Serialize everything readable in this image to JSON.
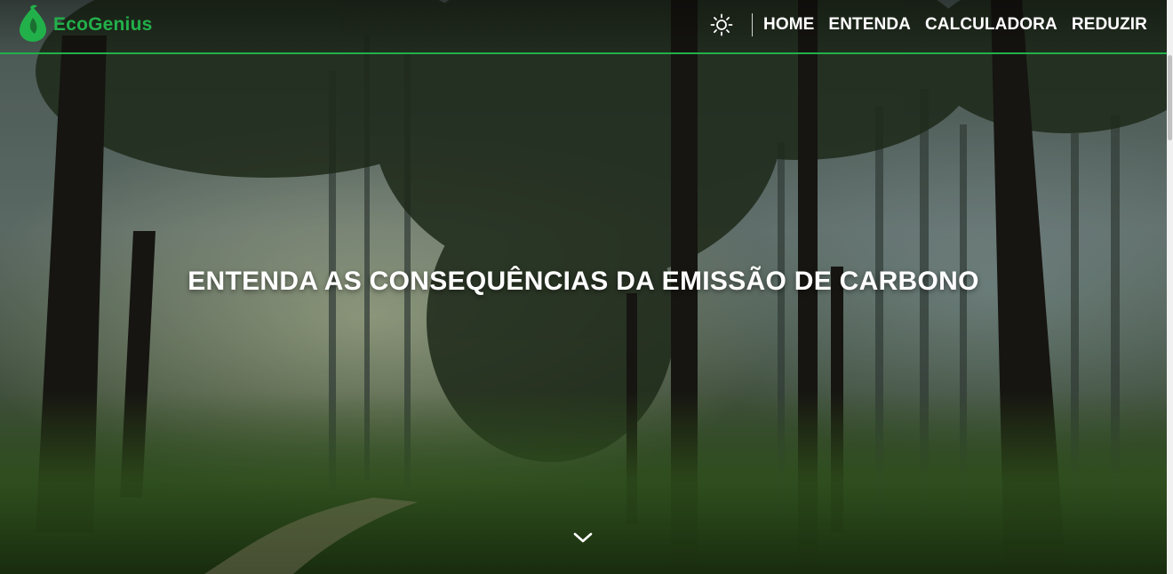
{
  "brand": {
    "name": "EcoGenius",
    "logo_icon": "leaf-drop-icon",
    "color": "#22b04a"
  },
  "nav": {
    "theme_icon": "sun-icon",
    "links": [
      {
        "label": "HOME"
      },
      {
        "label": "ENTENDA"
      },
      {
        "label": "CALCULADORA"
      },
      {
        "label": "REDUZIR"
      }
    ]
  },
  "hero": {
    "title": "ENTENDA AS CONSEQUÊNCIAS DA EMISSÃO DE CARBONO",
    "background": "forest-photo",
    "scroll_icon": "chevron-down-icon"
  },
  "colors": {
    "accent": "#22b04a",
    "text": "#ffffff"
  }
}
